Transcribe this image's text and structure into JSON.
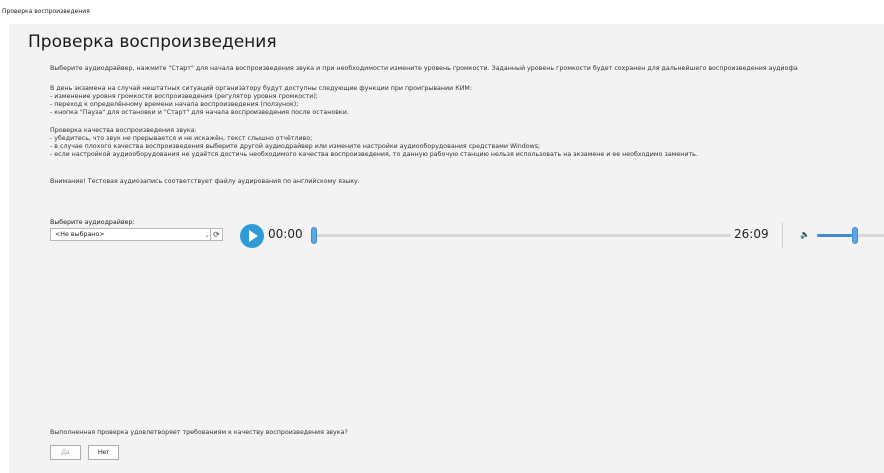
{
  "window": {
    "title": "Проверка воспроизведения"
  },
  "page": {
    "title": "Проверка воспроизведения"
  },
  "lines": [
    "Выберите аудиодрайвер, нажмите \"Старт\" для начала воспроизведения звука и при необходимости измените уровень громкости. Заданный уровень громкости будет сохранен для дальнейшего воспроизведения аудиофа",
    "В день экзамена на случай нештатных ситуаций организатору будут доступны следующие функции при проигрывании КИМ:",
    " - изменение уровня громкости воспроизведения (регулятор уровня громкости);",
    " - переход к определённому времени начала воспроизведения (ползунок);",
    " - кнопка \"Пауза\" для остановки и \"Старт\" для начала воспроизведения после остановки.",
    "Проверка качества воспроизведения звука:",
    " - убедитесь, что звук не прерывается и не искажён, текст слышно отчётливо;",
    " - в случае плохого качества воспроизведения выберите другой аудиодрайвер или измените настройки аудиооборудования средствами Windows;",
    " - если настройкой аудиооборудования не удаётся достичь необходимого качества воспроизведения, то данную рабочую станцию нельзя использовать на экзамене и ее необходимо заменить.",
    "Внимание! Тестовая аудиозапись соответствует файлу аудирования по английскому языку."
  ],
  "driver": {
    "label": "Выберите аудиодрайвер:",
    "selected": "<Не выбрано>"
  },
  "icons": {
    "refresh": "refresh-icon",
    "play": "play-icon",
    "volume": "volume-icon",
    "dropdown": "chevron-down-icon"
  },
  "player": {
    "current_time": "00:00",
    "total_time": "26:09",
    "progress_fraction": 0,
    "volume_fraction": 0.5
  },
  "confirm": {
    "question": "Выполненная проверка удовлетворяет требованиям к качеству воспроизведения звука?",
    "yes_label": "Да",
    "no_label": "Нет"
  },
  "colors": {
    "accent": "#2f9ad6",
    "panel": "#f3f3f3"
  }
}
